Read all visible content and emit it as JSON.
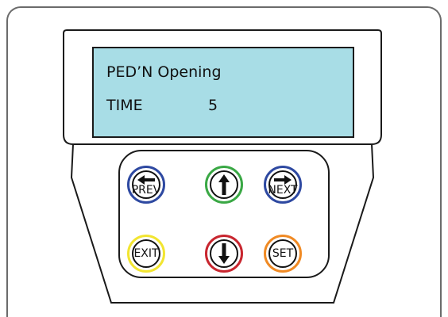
{
  "display": {
    "line1": "PED’N Opening",
    "line2_label": "TIME",
    "line2_value": "5"
  },
  "buttons": {
    "prev": {
      "label": "PREV",
      "icon": "arrow-left-icon",
      "ring_color": "#2e49a1"
    },
    "up": {
      "icon": "arrow-up-icon",
      "ring_color": "#3aa845"
    },
    "next": {
      "label": "NEXT",
      "icon": "arrow-right-icon",
      "ring_color": "#2e49a1"
    },
    "exit": {
      "label": "EXIT",
      "ring_color": "#f2e531"
    },
    "down": {
      "icon": "arrow-down-icon",
      "ring_color": "#c8262f"
    },
    "set": {
      "label": "SET",
      "ring_color": "#f08a24"
    }
  },
  "colors": {
    "lcd_background": "#a8dde6",
    "outline": "#1a1a1a",
    "frame": "#6b6b6b"
  }
}
